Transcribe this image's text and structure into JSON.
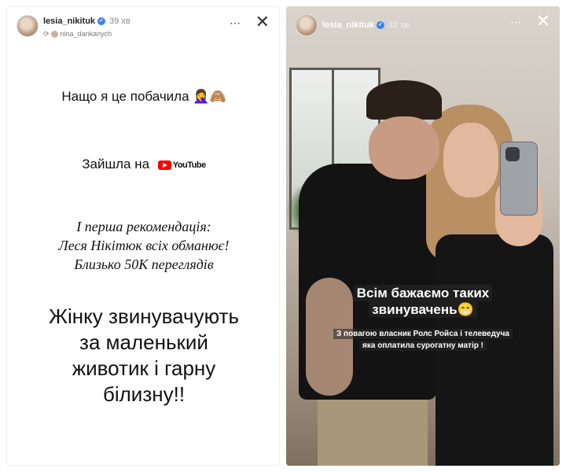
{
  "left_story": {
    "username": "lesia_nikituk",
    "time": "39 хв",
    "reposted_from": "nina_dankanych",
    "line1": "Нащо я це побачила 🤦‍♀️🙈",
    "line2_text": "Зайшла на",
    "youtube_label": "YouTube",
    "quote_lines": [
      "І перша рекомендація:",
      "Леся Нікітюк всіх обманює!",
      "Близько 50К переглядів"
    ],
    "big_lines": [
      "Жінку звинувачують",
      "за маленький",
      "животик і гарну",
      "білизну!!"
    ]
  },
  "right_story": {
    "username": "lesia_nikituk",
    "time": "32 хв",
    "caption_lines": [
      "Всім бажаємо таких",
      "звинувачень😁"
    ],
    "small_lines": [
      "З повагою власник Ролс Ройса і телеведуча",
      "яка оплатила сурогатну матір !"
    ]
  },
  "icons": {
    "more": "⋯",
    "close": "✕",
    "verified": "✓"
  },
  "colors": {
    "youtube_red": "#ff0000",
    "verified_blue": "#3b82f6"
  }
}
